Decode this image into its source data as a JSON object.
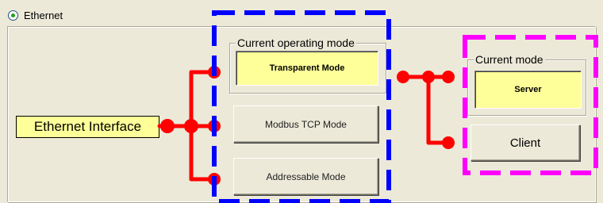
{
  "radio": {
    "label": "Ethernet",
    "checked": true
  },
  "interface_label": "Ethernet Interface",
  "operating_mode_group": {
    "title": "Current operating mode",
    "current_value": "Transparent Mode"
  },
  "mode_buttons": {
    "modbus": "Modbus TCP Mode",
    "addressable": "Addressable Mode"
  },
  "current_mode_group": {
    "title": "Current mode",
    "current_value": "Server"
  },
  "client_button": "Client",
  "colors": {
    "connector": "#ff0000",
    "operating_mode_highlight": "#0000ff",
    "current_mode_highlight": "#ff00ff",
    "value_background": "#ffff99"
  }
}
